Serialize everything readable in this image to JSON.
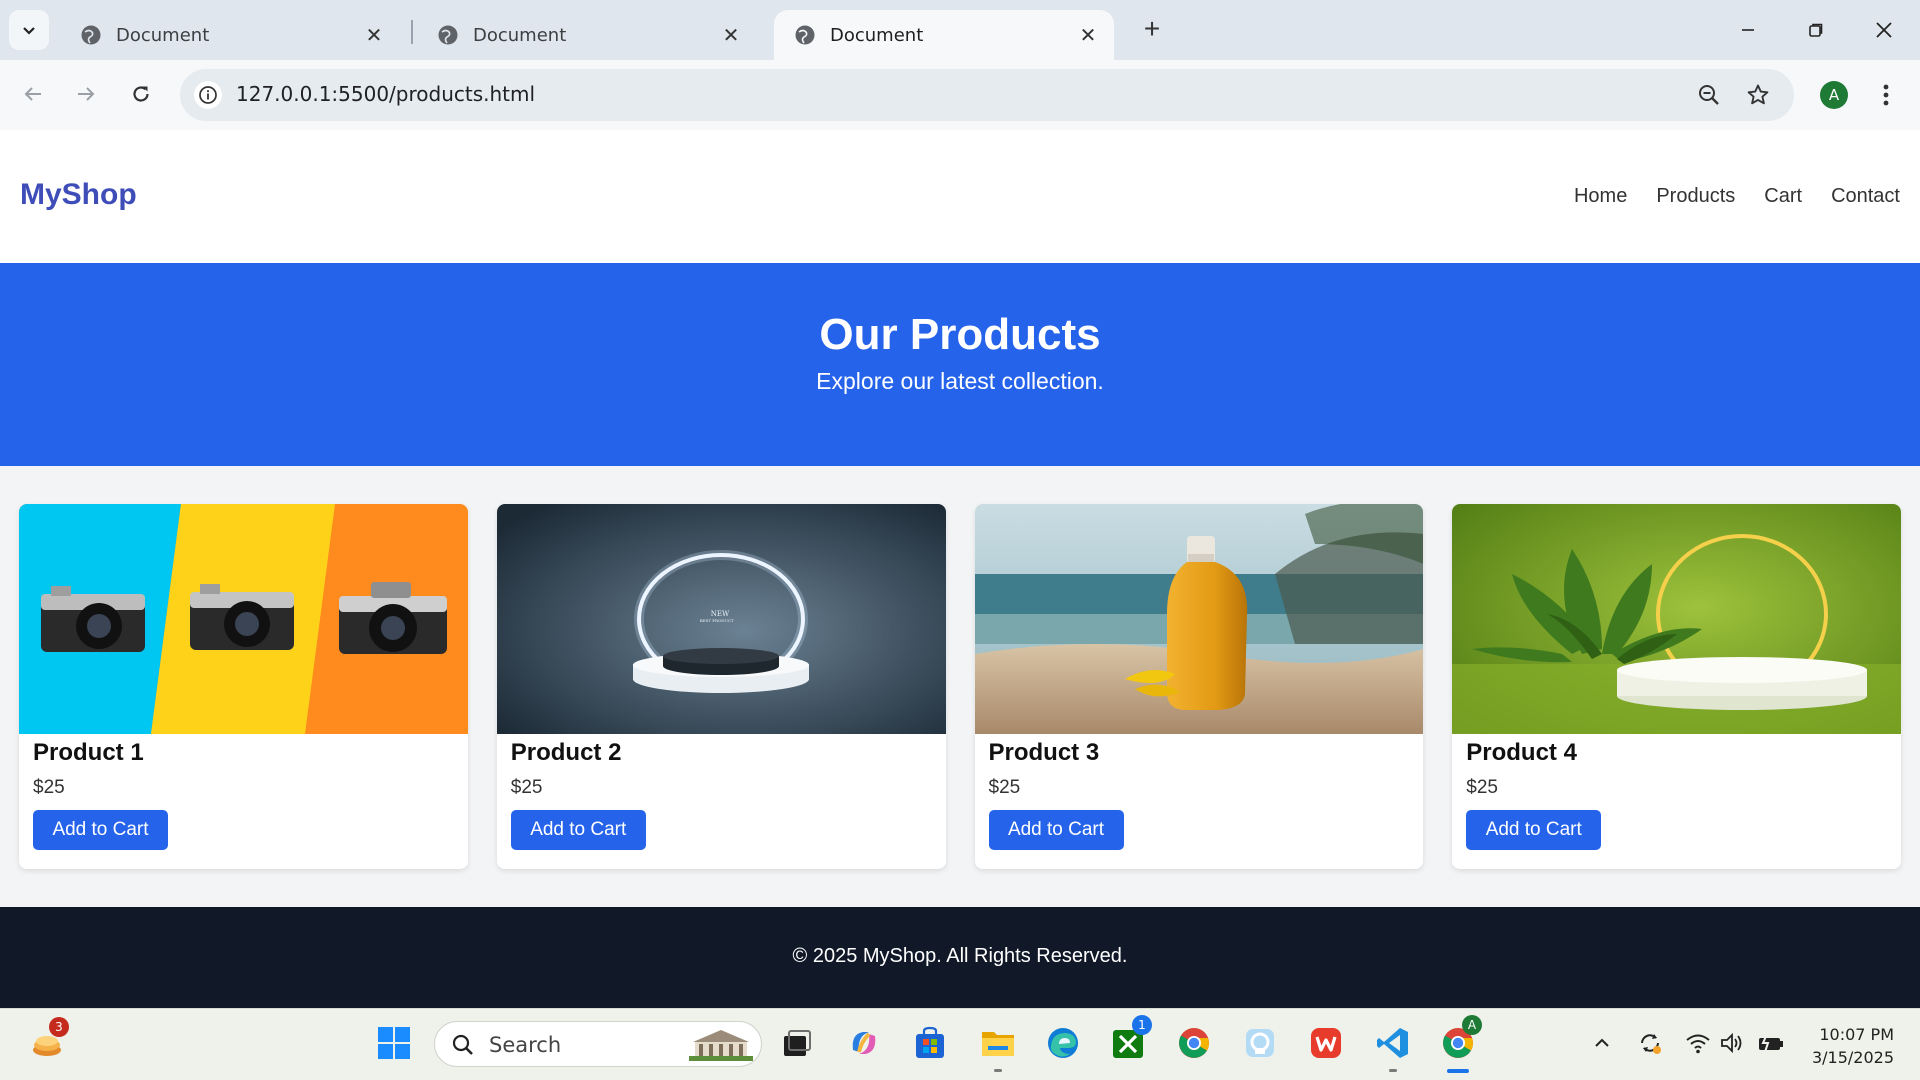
{
  "browser": {
    "tabs": [
      {
        "title": "Document",
        "active": false
      },
      {
        "title": "Document",
        "active": false
      },
      {
        "title": "Document",
        "active": true
      }
    ],
    "url": "127.0.0.1:5500/products.html",
    "profile_initial": "A"
  },
  "site": {
    "brand": "MyShop",
    "nav": [
      "Home",
      "Products",
      "Cart",
      "Contact"
    ],
    "hero": {
      "title": "Our Products",
      "subtitle": "Explore our latest collection."
    },
    "products": [
      {
        "name": "Product 1",
        "price": "$25",
        "button": "Add to Cart",
        "image": "vintage-cameras-photo"
      },
      {
        "name": "Product 2",
        "price": "$25",
        "button": "Add to Cart",
        "image": "podium-neon-ring-photo",
        "image_text": [
          "NEW",
          "BEST PRODUCT"
        ]
      },
      {
        "name": "Product 3",
        "price": "$25",
        "button": "Add to Cart",
        "image": "sunscreen-beach-photo"
      },
      {
        "name": "Product 4",
        "price": "$25",
        "button": "Add to Cart",
        "image": "green-podium-leaves-photo"
      }
    ],
    "footer": "© 2025 MyShop. All Rights Reserved."
  },
  "taskbar": {
    "widgets_badge": "3",
    "search_placeholder": "Search",
    "xbox_badge": "1",
    "chrome_profile": "A",
    "time": "10:07 PM",
    "date": "3/15/2025"
  },
  "colors": {
    "brand": "#3f4db8",
    "primary": "#2563eb",
    "footer_bg": "#111827"
  }
}
